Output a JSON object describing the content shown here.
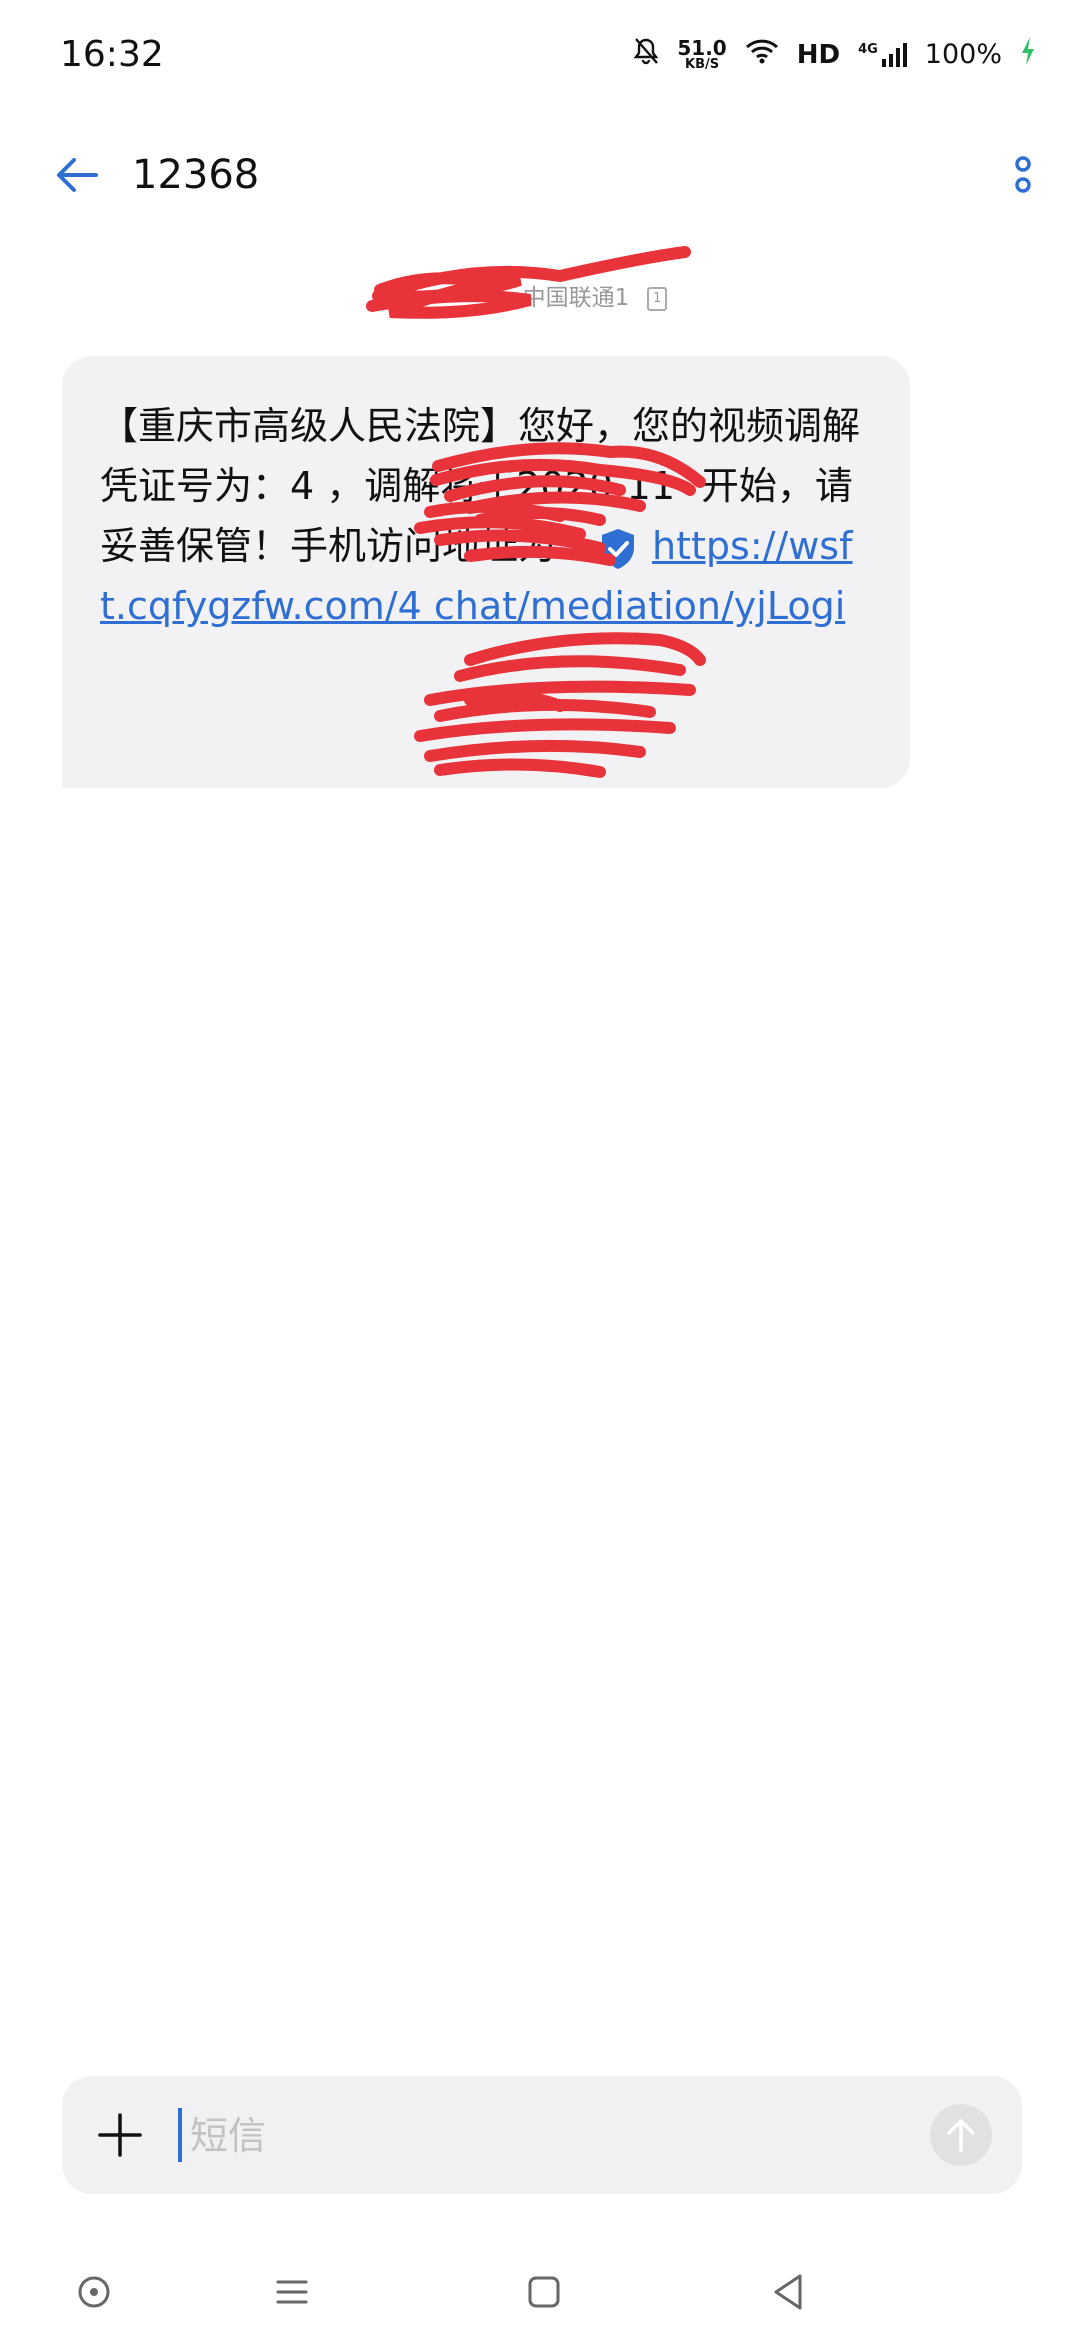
{
  "status_bar": {
    "time": "16:32",
    "net_speed_value": "51.0",
    "net_speed_unit": "KB/S",
    "hd_label": "HD",
    "network_type": "4G",
    "battery_percent": "100%",
    "icons": [
      "bell-muted-icon",
      "wifi-icon",
      "signal-icon",
      "charging-icon"
    ]
  },
  "header": {
    "title": "12368",
    "back_icon": "arrow-left-icon",
    "more_icon": "more-vertical-icon"
  },
  "message": {
    "sim_label": "中国联通1",
    "sim_slot": "1",
    "body_before_link": "【重庆市高级人民法院】您好，您的视频调解凭证号为：4           ，调解将于2020-11-             开始，请妥善保管！手机访问地址为：",
    "link_text": "https://wsft.cqfygzfw.com/4            chat/mediation/yjLogi"
  },
  "composer": {
    "placeholder": "短信",
    "value": ""
  },
  "nav_bar": {
    "icons": [
      "assistant-dot-icon",
      "menu-icon",
      "home-square-icon",
      "back-triangle-icon"
    ]
  },
  "colors": {
    "accent": "#2f6fd4",
    "bubble_bg": "#f2f2f4",
    "redaction": "#e8333a",
    "charging": "#31c16a"
  }
}
